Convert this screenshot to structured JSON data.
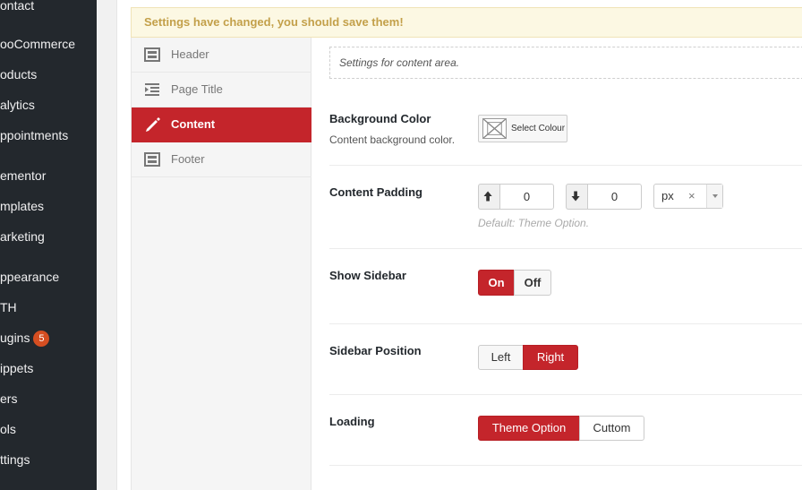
{
  "sidebar": {
    "items": [
      {
        "label": "ontact"
      },
      {
        "label": "ooCommerce"
      },
      {
        "label": "oducts"
      },
      {
        "label": "alytics"
      },
      {
        "label": "ppointments"
      },
      {
        "label": "ementor"
      },
      {
        "label": "mplates"
      },
      {
        "label": "arketing"
      },
      {
        "label": "ppearance"
      },
      {
        "label": "TH"
      },
      {
        "label": "ugins",
        "badge": "5"
      },
      {
        "label": "ippets"
      },
      {
        "label": "ers"
      },
      {
        "label": "ols"
      },
      {
        "label": "ttings"
      }
    ]
  },
  "notice": {
    "text": "Settings have changed, you should save them!"
  },
  "tabs": [
    {
      "label": "Header",
      "icon": "layout-icon"
    },
    {
      "label": "Page Title",
      "icon": "indent-icon"
    },
    {
      "label": "Content",
      "icon": "pencil-icon",
      "active": true
    },
    {
      "label": "Footer",
      "icon": "layout-icon"
    }
  ],
  "section": {
    "description": "Settings for content area."
  },
  "fields": {
    "background_color": {
      "label": "Background Color",
      "sub": "Content background color.",
      "button": "Select Colour"
    },
    "content_padding": {
      "label": "Content Padding",
      "top": "0",
      "bottom": "0",
      "unit": "px",
      "clear": "×",
      "hint": "Default: Theme Option."
    },
    "show_sidebar": {
      "label": "Show Sidebar",
      "on": "On",
      "off": "Off",
      "selected": "On"
    },
    "sidebar_position": {
      "label": "Sidebar Position",
      "left": "Left",
      "right": "Right",
      "selected": "Right"
    },
    "loading": {
      "label": "Loading",
      "theme_option": "Theme Option",
      "custom": "Cuttom",
      "selected": "Theme Option"
    }
  },
  "colors": {
    "accent": "#c4252b",
    "sidebar_bg": "#23282d",
    "notice_bg": "#fcf8e3",
    "badge": "#d54e21"
  }
}
